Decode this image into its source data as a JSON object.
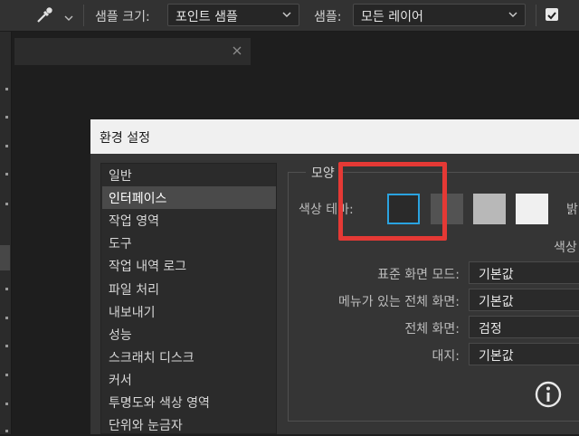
{
  "options_bar": {
    "sample_size_label": "샘플 크기:",
    "sample_size_value": "포인트 샘플",
    "sample_label": "샘플:",
    "sample_value": "모든 레이어",
    "show_ring_checked": true
  },
  "dialog": {
    "title": "환경 설정",
    "categories": [
      "일반",
      "인터페이스",
      "작업 영역",
      "도구",
      "작업 내역 로그",
      "파일 처리",
      "내보내기",
      "성능",
      "스크래치 디스크",
      "커서",
      "투명도와 색상 영역",
      "단위와 눈금자"
    ],
    "selected_category": "인터페이스",
    "appearance": {
      "group_title": "모양",
      "color_theme_label": "색상 테마:",
      "theme_swatches": [
        "#2a2a2a",
        "#535353",
        "#b8b8b8",
        "#f0f0f0"
      ],
      "selected_swatch_index": 0,
      "selection_color": "#2aa3e0",
      "cut_label_right_1": "밝",
      "cut_label_right_2": "색상",
      "settings": [
        {
          "label": "표준 화면 모드:",
          "value": "기본값"
        },
        {
          "label": "메뉴가 있는 전체 화면:",
          "value": "기본값"
        },
        {
          "label": "전체 화면:",
          "value": "검정"
        },
        {
          "label": "대지:",
          "value": "기본값"
        }
      ]
    }
  },
  "annotation_color": "#e53935",
  "icons": [
    "eyedropper-icon",
    "chevron-down-icon",
    "close-icon",
    "info-icon",
    "checkbox-checked-icon"
  ]
}
